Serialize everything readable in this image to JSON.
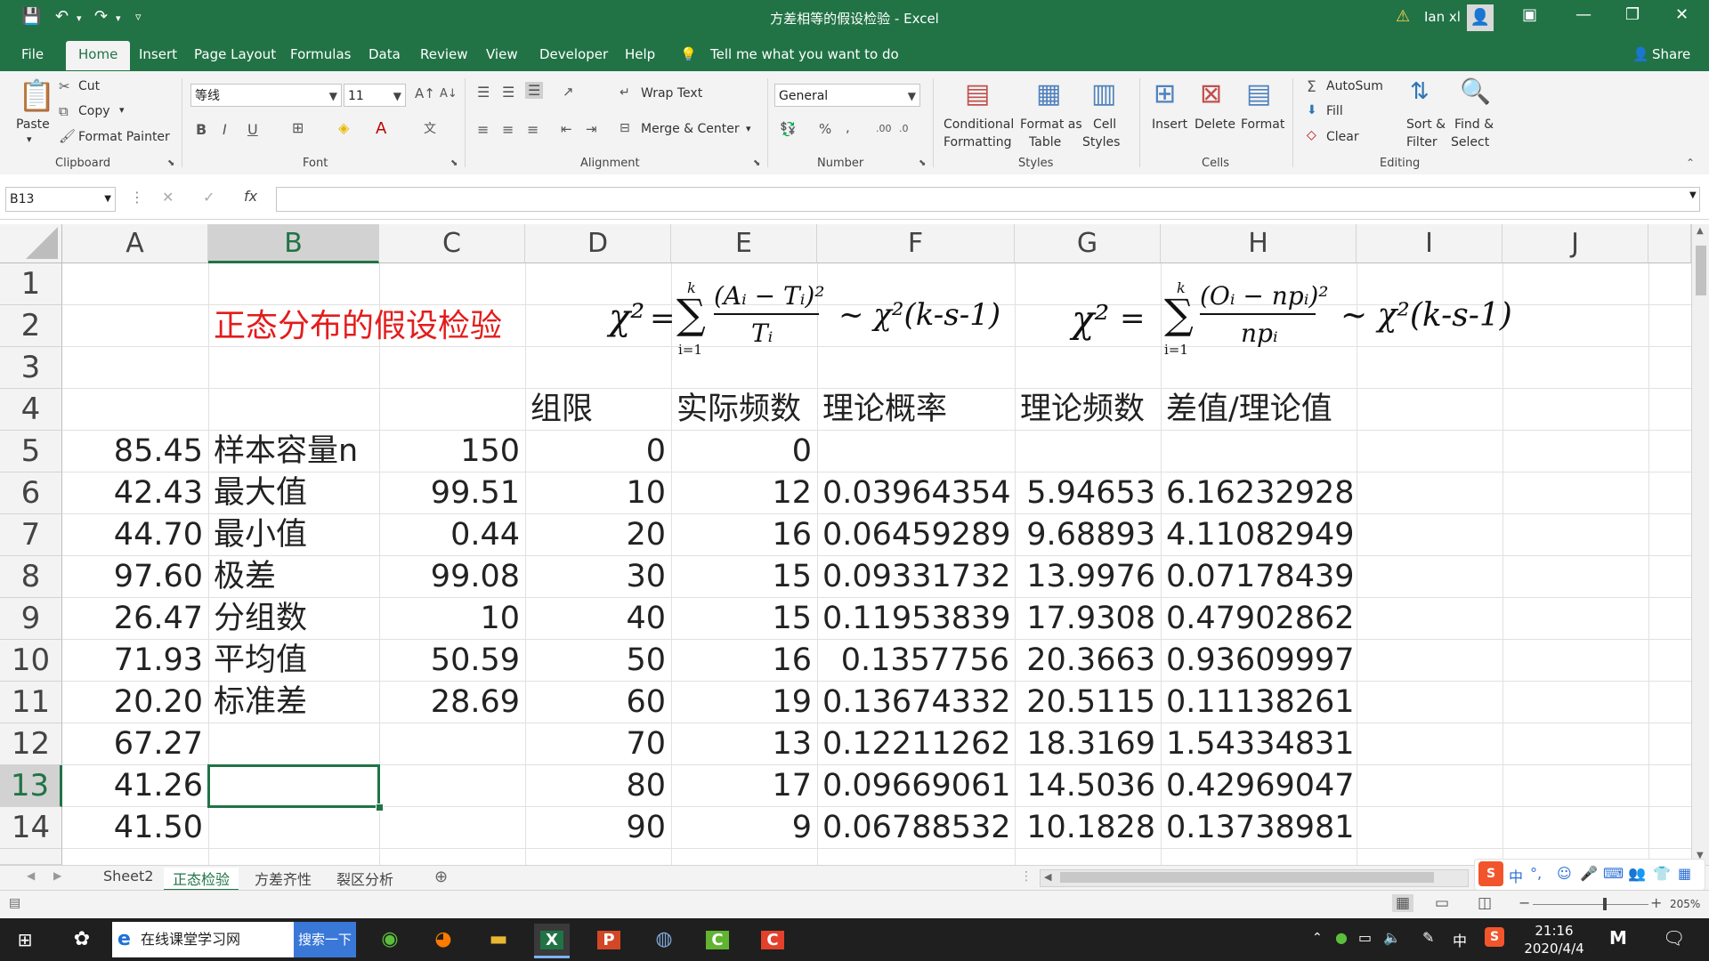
{
  "window": {
    "title": "方差相等的假设检验  -  Excel",
    "user": "Ian xl",
    "warning_icon": "warning-icon",
    "accent_color": "#217346"
  },
  "tabs": [
    "File",
    "Home",
    "Insert",
    "Page Layout",
    "Formulas",
    "Data",
    "Review",
    "View",
    "Developer",
    "Help"
  ],
  "tell_me": "Tell me what you want to do",
  "share": "Share",
  "ribbon": {
    "clipboard": {
      "paste": "Paste",
      "cut": "Cut",
      "copy": "Copy",
      "format_painter": "Format Painter",
      "group": "Clipboard"
    },
    "font": {
      "name": "等线",
      "size": "11",
      "group": "Font"
    },
    "alignment": {
      "wrap": "Wrap Text",
      "merge": "Merge & Center",
      "group": "Alignment"
    },
    "number": {
      "format": "General",
      "group": "Number"
    },
    "styles": {
      "conditional_1": "Conditional",
      "conditional_2": "Formatting",
      "format_as_1": "Format as",
      "format_as_2": "Table",
      "cell_1": "Cell",
      "cell_2": "Styles",
      "group": "Styles"
    },
    "cells": {
      "insert": "Insert",
      "delete": "Delete",
      "format": "Format",
      "group": "Cells"
    },
    "editing": {
      "autosum": "AutoSum",
      "fill": "Fill",
      "clear": "Clear",
      "sort_1": "Sort &",
      "sort_2": "Filter",
      "find_1": "Find &",
      "find_2": "Select",
      "group": "Editing"
    }
  },
  "formula_bar": {
    "name_box": "B13",
    "fx": "fx",
    "content": ""
  },
  "columns": [
    "A",
    "B",
    "C",
    "D",
    "E",
    "F",
    "G",
    "H",
    "I",
    "J"
  ],
  "rows": [
    "1",
    "2",
    "3",
    "4",
    "5",
    "6",
    "7",
    "8",
    "9",
    "10",
    "11",
    "12",
    "13",
    "14"
  ],
  "sheet_title": "正态分布的假设检验",
  "formula_left": {
    "lhs": "χ²",
    "sum_top": "k",
    "sum_bot": "i=1",
    "num": "(Aᵢ − Tᵢ)²",
    "den": "Tᵢ",
    "rhs": "~ χ²(k-s-1)"
  },
  "formula_right": {
    "lhs": "χ²",
    "sum_top": "k",
    "sum_bot": "i=1",
    "num": "(Oᵢ − npᵢ)²",
    "den": "npᵢ",
    "rhs": "~ χ²(k-s-1)"
  },
  "headers_row4": {
    "D": "组限",
    "E": "实际频数",
    "F": "理论概率",
    "G": "理论频数",
    "H": "差值/理论值"
  },
  "col_a": [
    "85.45",
    "42.43",
    "44.70",
    "97.60",
    "26.47",
    "71.93",
    "20.20",
    "67.27",
    "41.26",
    "41.50"
  ],
  "stats": [
    {
      "label": "样本容量n",
      "value": "150"
    },
    {
      "label": "最大值",
      "value": "99.51"
    },
    {
      "label": "最小值",
      "value": "0.44"
    },
    {
      "label": "极差",
      "value": "99.08"
    },
    {
      "label": "分组数",
      "value": "10"
    },
    {
      "label": "平均值",
      "value": "50.59"
    },
    {
      "label": "标准差",
      "value": "28.69"
    }
  ],
  "table_rows": [
    {
      "d": "0",
      "e": "0",
      "f": "",
      "g": "",
      "h": ""
    },
    {
      "d": "10",
      "e": "12",
      "f": "0.03964354",
      "g": "5.94653",
      "h": "6.16232928"
    },
    {
      "d": "20",
      "e": "16",
      "f": "0.06459289",
      "g": "9.68893",
      "h": "4.11082949"
    },
    {
      "d": "30",
      "e": "15",
      "f": "0.09331732",
      "g": "13.9976",
      "h": "0.07178439"
    },
    {
      "d": "40",
      "e": "15",
      "f": "0.11953839",
      "g": "17.9308",
      "h": "0.47902862"
    },
    {
      "d": "50",
      "e": "16",
      "f": "0.1357756",
      "g": "20.3663",
      "h": "0.93609997"
    },
    {
      "d": "60",
      "e": "19",
      "f": "0.13674332",
      "g": "20.5115",
      "h": "0.11138261"
    },
    {
      "d": "70",
      "e": "13",
      "f": "0.12211262",
      "g": "18.3169",
      "h": "1.54334831"
    },
    {
      "d": "80",
      "e": "17",
      "f": "0.09669061",
      "g": "14.5036",
      "h": "0.42969047"
    },
    {
      "d": "90",
      "e": "9",
      "f": "0.06788532",
      "g": "10.1828",
      "h": "0.13738981"
    }
  ],
  "sheet_tabs": [
    "Sheet2",
    "正态检验",
    "方差齐性",
    "裂区分析"
  ],
  "active_sheet": "正态检验",
  "zoom": "205%",
  "taskbar": {
    "search_text": "在线课堂学习网",
    "search_button": "搜索一下",
    "time": "21:16",
    "date": "2020/4/4",
    "ime": "中"
  }
}
